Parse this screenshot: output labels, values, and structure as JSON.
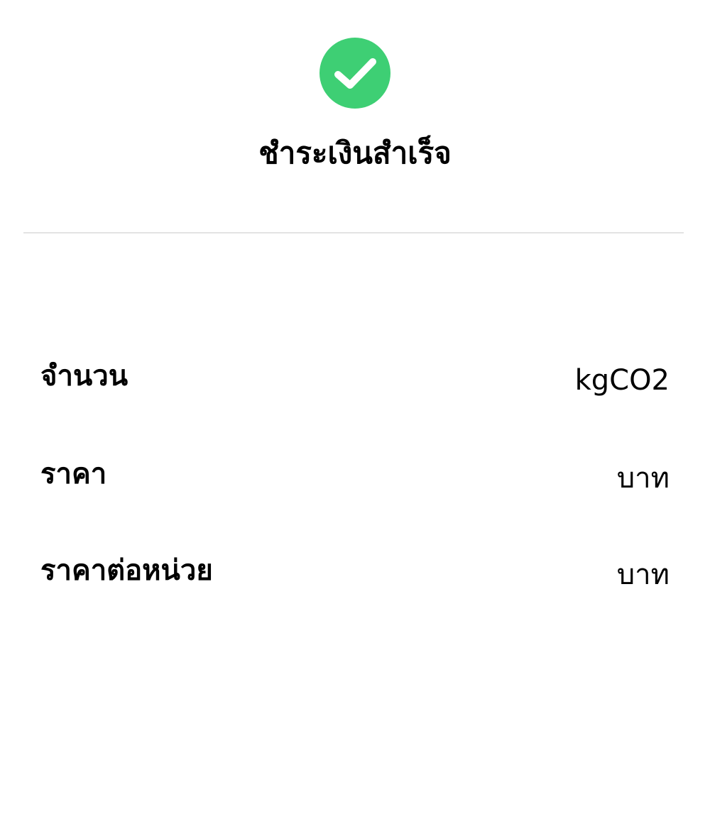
{
  "status": {
    "icon": "check-circle-icon",
    "icon_color": "#3ecf74",
    "title": "ชำระเงินสำเร็จ"
  },
  "details": [
    {
      "label": "จำนวน",
      "value": "kgCO2"
    },
    {
      "label": "ราคา",
      "value": "บาท"
    },
    {
      "label": "ราคาต่อหน่วย",
      "value": "บาท"
    }
  ]
}
